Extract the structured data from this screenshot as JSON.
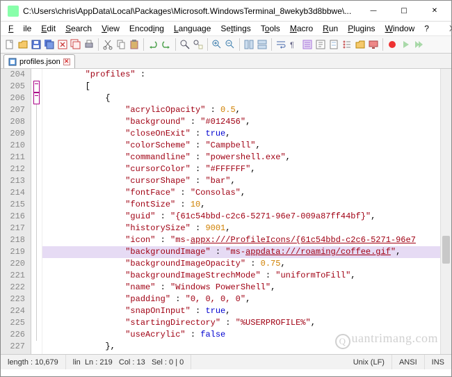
{
  "window": {
    "title": "C:\\Users\\chris\\AppData\\Local\\Packages\\Microsoft.WindowsTerminal_8wekyb3d8bbwe\\..."
  },
  "menu": {
    "file": "File",
    "edit": "Edit",
    "search": "Search",
    "view": "View",
    "encoding": "Encoding",
    "language": "Language",
    "settings": "Settings",
    "tools": "Tools",
    "macro": "Macro",
    "run": "Run",
    "plugins": "Plugins",
    "window": "Window",
    "help": "?",
    "x": "X"
  },
  "tab": {
    "name": "profiles.json"
  },
  "lines": {
    "start": 204,
    "end": 227,
    "highlight": 219,
    "content": [
      {
        "n": 204,
        "indent": "        ",
        "tokens": [
          {
            "t": "s",
            "v": "\"profiles\""
          },
          {
            "t": "p",
            "v": " :"
          }
        ]
      },
      {
        "n": 205,
        "indent": "        ",
        "tokens": [
          {
            "t": "c",
            "v": "["
          }
        ]
      },
      {
        "n": 206,
        "indent": "            ",
        "tokens": [
          {
            "t": "c",
            "v": "{"
          }
        ]
      },
      {
        "n": 207,
        "indent": "                ",
        "tokens": [
          {
            "t": "s",
            "v": "\"acrylicOpacity\""
          },
          {
            "t": "p",
            "v": " : "
          },
          {
            "t": "n",
            "v": "0.5"
          },
          {
            "t": "p",
            "v": ","
          }
        ]
      },
      {
        "n": 208,
        "indent": "                ",
        "tokens": [
          {
            "t": "s",
            "v": "\"background\""
          },
          {
            "t": "p",
            "v": " : "
          },
          {
            "t": "s",
            "v": "\"#012456\""
          },
          {
            "t": "p",
            "v": ","
          }
        ]
      },
      {
        "n": 209,
        "indent": "                ",
        "tokens": [
          {
            "t": "s",
            "v": "\"closeOnExit\""
          },
          {
            "t": "p",
            "v": " : "
          },
          {
            "t": "k",
            "v": "true"
          },
          {
            "t": "p",
            "v": ","
          }
        ]
      },
      {
        "n": 210,
        "indent": "                ",
        "tokens": [
          {
            "t": "s",
            "v": "\"colorScheme\""
          },
          {
            "t": "p",
            "v": " : "
          },
          {
            "t": "s",
            "v": "\"Campbell\""
          },
          {
            "t": "p",
            "v": ","
          }
        ]
      },
      {
        "n": 211,
        "indent": "                ",
        "tokens": [
          {
            "t": "s",
            "v": "\"commandline\""
          },
          {
            "t": "p",
            "v": " : "
          },
          {
            "t": "s",
            "v": "\"powershell.exe\""
          },
          {
            "t": "p",
            "v": ","
          }
        ]
      },
      {
        "n": 212,
        "indent": "                ",
        "tokens": [
          {
            "t": "s",
            "v": "\"cursorColor\""
          },
          {
            "t": "p",
            "v": " : "
          },
          {
            "t": "s",
            "v": "\"#FFFFFF\""
          },
          {
            "t": "p",
            "v": ","
          }
        ]
      },
      {
        "n": 213,
        "indent": "                ",
        "tokens": [
          {
            "t": "s",
            "v": "\"cursorShape\""
          },
          {
            "t": "p",
            "v": " : "
          },
          {
            "t": "s",
            "v": "\"bar\""
          },
          {
            "t": "p",
            "v": ","
          }
        ]
      },
      {
        "n": 214,
        "indent": "                ",
        "tokens": [
          {
            "t": "s",
            "v": "\"fontFace\""
          },
          {
            "t": "p",
            "v": " : "
          },
          {
            "t": "s",
            "v": "\"Consolas\""
          },
          {
            "t": "p",
            "v": ","
          }
        ]
      },
      {
        "n": 215,
        "indent": "                ",
        "tokens": [
          {
            "t": "s",
            "v": "\"fontSize\""
          },
          {
            "t": "p",
            "v": " : "
          },
          {
            "t": "n",
            "v": "10"
          },
          {
            "t": "p",
            "v": ","
          }
        ]
      },
      {
        "n": 216,
        "indent": "                ",
        "tokens": [
          {
            "t": "s",
            "v": "\"guid\""
          },
          {
            "t": "p",
            "v": " : "
          },
          {
            "t": "s",
            "v": "\"{61c54bbd-c2c6-5271-96e7-009a87ff44bf}\""
          },
          {
            "t": "p",
            "v": ","
          }
        ]
      },
      {
        "n": 217,
        "indent": "                ",
        "tokens": [
          {
            "t": "s",
            "v": "\"historySize\""
          },
          {
            "t": "p",
            "v": " : "
          },
          {
            "t": "n",
            "v": "9001"
          },
          {
            "t": "p",
            "v": ","
          }
        ]
      },
      {
        "n": 218,
        "indent": "                ",
        "tokens": [
          {
            "t": "s",
            "v": "\"icon\""
          },
          {
            "t": "p",
            "v": " : "
          },
          {
            "t": "s",
            "v": "\"ms-",
            "lk": false
          },
          {
            "t": "s",
            "v": "appx:///ProfileIcons/{61c54bbd-c2c6-5271-96e7",
            "lk": true
          }
        ]
      },
      {
        "n": 219,
        "indent": "                ",
        "tokens": [
          {
            "t": "s",
            "v": "\"backgroundImage\""
          },
          {
            "t": "p",
            "v": " : "
          },
          {
            "t": "s",
            "v": "\"ms-"
          },
          {
            "t": "s",
            "v": "appdata:///roaming/coffee.gif",
            "lk": true
          },
          {
            "t": "s",
            "v": "\""
          },
          {
            "t": "p",
            "v": ","
          }
        ]
      },
      {
        "n": 220,
        "indent": "                ",
        "tokens": [
          {
            "t": "s",
            "v": "\"backgroundImageOpacity\""
          },
          {
            "t": "p",
            "v": " : "
          },
          {
            "t": "n",
            "v": "0.75"
          },
          {
            "t": "p",
            "v": ","
          }
        ]
      },
      {
        "n": 221,
        "indent": "                ",
        "tokens": [
          {
            "t": "s",
            "v": "\"backgroundImageStrechMode\""
          },
          {
            "t": "p",
            "v": " : "
          },
          {
            "t": "s",
            "v": "\"uniformToFill\""
          },
          {
            "t": "p",
            "v": ","
          }
        ]
      },
      {
        "n": 222,
        "indent": "                ",
        "tokens": [
          {
            "t": "s",
            "v": "\"name\""
          },
          {
            "t": "p",
            "v": " : "
          },
          {
            "t": "s",
            "v": "\"Windows PowerShell\""
          },
          {
            "t": "p",
            "v": ","
          }
        ]
      },
      {
        "n": 223,
        "indent": "                ",
        "tokens": [
          {
            "t": "s",
            "v": "\"padding\""
          },
          {
            "t": "p",
            "v": " : "
          },
          {
            "t": "s",
            "v": "\"0, 0, 0, 0\""
          },
          {
            "t": "p",
            "v": ","
          }
        ]
      },
      {
        "n": 224,
        "indent": "                ",
        "tokens": [
          {
            "t": "s",
            "v": "\"snapOnInput\""
          },
          {
            "t": "p",
            "v": " : "
          },
          {
            "t": "k",
            "v": "true"
          },
          {
            "t": "p",
            "v": ","
          }
        ]
      },
      {
        "n": 225,
        "indent": "                ",
        "tokens": [
          {
            "t": "s",
            "v": "\"startingDirectory\""
          },
          {
            "t": "p",
            "v": " : "
          },
          {
            "t": "s",
            "v": "\"%USERPROFILE%\""
          },
          {
            "t": "p",
            "v": ","
          }
        ]
      },
      {
        "n": 226,
        "indent": "                ",
        "tokens": [
          {
            "t": "s",
            "v": "\"useAcrylic\""
          },
          {
            "t": "p",
            "v": " : "
          },
          {
            "t": "k",
            "v": "false"
          }
        ]
      },
      {
        "n": 227,
        "indent": "            ",
        "tokens": [
          {
            "t": "c",
            "v": "},"
          }
        ]
      }
    ]
  },
  "status": {
    "length": "length : 10,679",
    "lines": "lin",
    "ln": "Ln : 219",
    "col": "Col : 13",
    "sel": "Sel : 0 | 0",
    "eol": "Unix (LF)",
    "enc": "ANSI",
    "mode": "INS"
  },
  "watermark": "uantrimang.com"
}
